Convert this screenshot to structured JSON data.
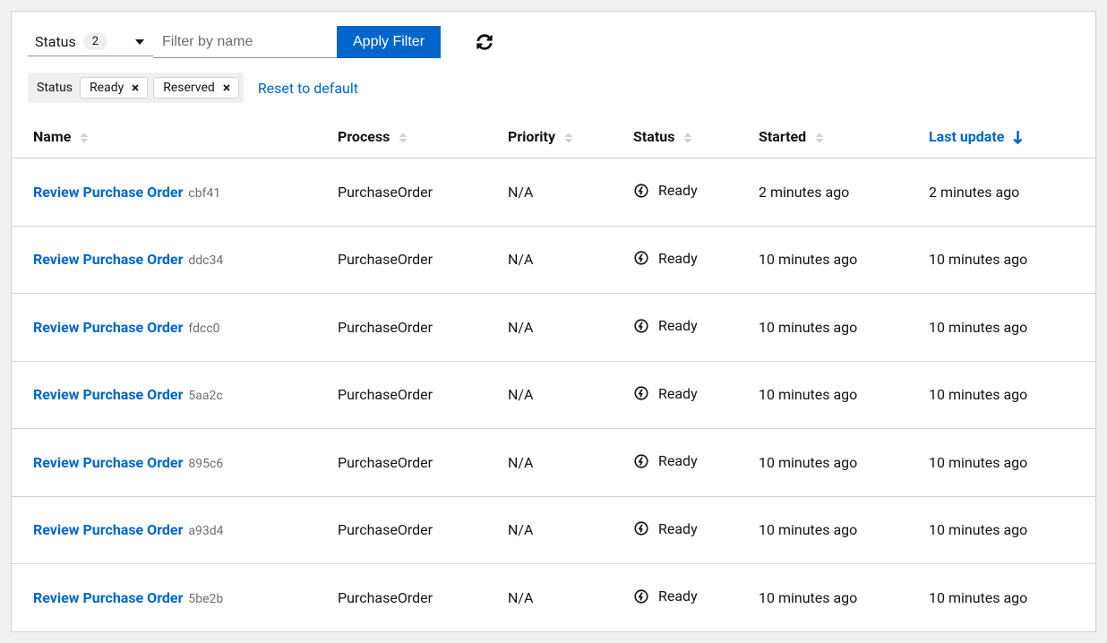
{
  "toolbar": {
    "status_label": "Status",
    "status_count": "2",
    "filter_placeholder": "Filter by name",
    "apply_label": "Apply Filter"
  },
  "chips": {
    "group_label": "Status",
    "items": [
      "Ready",
      "Reserved"
    ],
    "reset_label": "Reset to default"
  },
  "columns": {
    "name": "Name",
    "process": "Process",
    "priority": "Priority",
    "status": "Status",
    "started": "Started",
    "last_update": "Last update"
  },
  "rows": [
    {
      "name": "Review Purchase Order",
      "id": "cbf41",
      "process": "PurchaseOrder",
      "priority": "N/A",
      "status": "Ready",
      "started": "2 minutes ago",
      "last_update": "2 minutes ago"
    },
    {
      "name": "Review Purchase Order",
      "id": "ddc34",
      "process": "PurchaseOrder",
      "priority": "N/A",
      "status": "Ready",
      "started": "10 minutes ago",
      "last_update": "10 minutes ago"
    },
    {
      "name": "Review Purchase Order",
      "id": "fdcc0",
      "process": "PurchaseOrder",
      "priority": "N/A",
      "status": "Ready",
      "started": "10 minutes ago",
      "last_update": "10 minutes ago"
    },
    {
      "name": "Review Purchase Order",
      "id": "5aa2c",
      "process": "PurchaseOrder",
      "priority": "N/A",
      "status": "Ready",
      "started": "10 minutes ago",
      "last_update": "10 minutes ago"
    },
    {
      "name": "Review Purchase Order",
      "id": "895c6",
      "process": "PurchaseOrder",
      "priority": "N/A",
      "status": "Ready",
      "started": "10 minutes ago",
      "last_update": "10 minutes ago"
    },
    {
      "name": "Review Purchase Order",
      "id": "a93d4",
      "process": "PurchaseOrder",
      "priority": "N/A",
      "status": "Ready",
      "started": "10 minutes ago",
      "last_update": "10 minutes ago"
    },
    {
      "name": "Review Purchase Order",
      "id": "5be2b",
      "process": "PurchaseOrder",
      "priority": "N/A",
      "status": "Ready",
      "started": "10 minutes ago",
      "last_update": "10 minutes ago"
    }
  ]
}
